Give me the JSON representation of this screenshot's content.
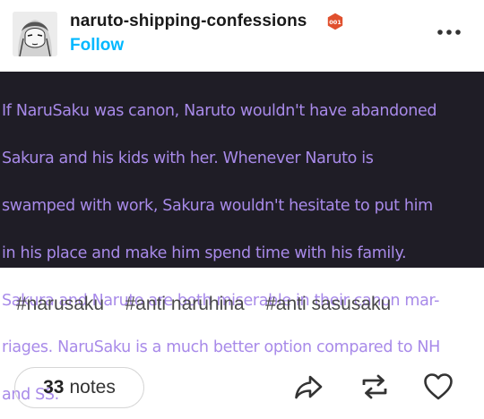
{
  "post": {
    "blog_name": "naruto-shipping-confessions",
    "follow_label": "Follow",
    "badge_text": "001",
    "body_lines": [
      "If NaruSaku was canon, Naruto wouldn't have abandoned",
      "Sakura and his kids with her. Whenever Naruto is",
      "swamped with work, Sakura wouldn't hesitate to put him",
      "in his place and make him spend time with his family.",
      "Sakura and Naruto are both miserable in their canon mar-",
      "riages. NaruSaku is a much better option compared to NH",
      "and SS."
    ],
    "tags": [
      "#narusaku",
      "#anti naruhina",
      "#anti sasusaku"
    ],
    "notes_count": "33",
    "notes_label": "notes"
  },
  "icons": {
    "more": "more-horizontal-icon",
    "share": "share-icon",
    "reblog": "reblog-icon",
    "like": "heart-icon",
    "badge": "hexagon-badge-icon"
  },
  "colors": {
    "follow": "#00b8ff",
    "confession_bg": "#1f1d26",
    "confession_text": "#a88ae9",
    "badge": "#e0502e"
  }
}
